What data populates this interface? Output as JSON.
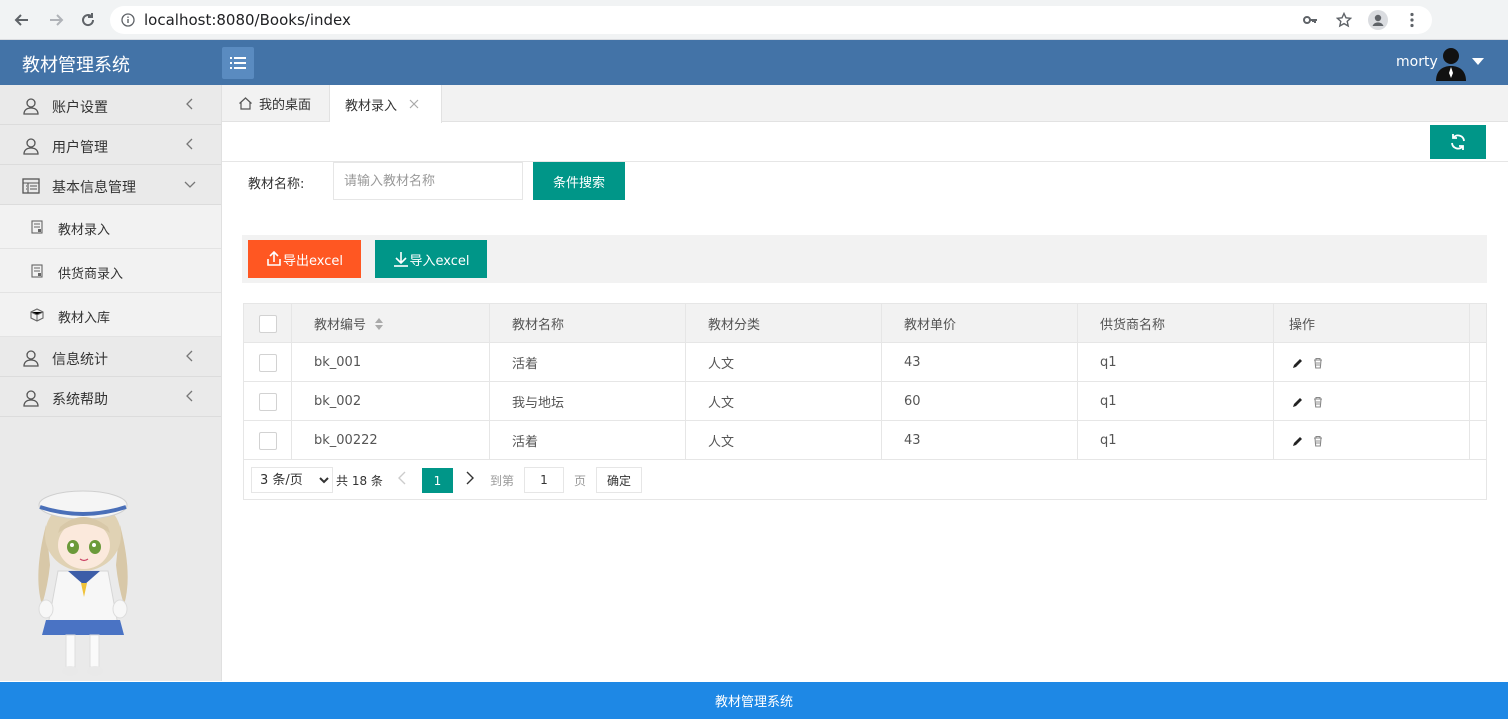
{
  "browser": {
    "url": "localhost:8080/Books/index"
  },
  "header": {
    "app_title": "教材管理系统",
    "user_name": "morty"
  },
  "sidebar": {
    "items": [
      {
        "label": "账户设置",
        "icon": "user-icon",
        "expanded": false
      },
      {
        "label": "用户管理",
        "icon": "user-icon",
        "expanded": false
      },
      {
        "label": "基本信息管理",
        "icon": "table-icon",
        "expanded": true
      },
      {
        "label": "信息统计",
        "icon": "user-icon",
        "expanded": false
      },
      {
        "label": "系统帮助",
        "icon": "user-icon",
        "expanded": false
      }
    ],
    "subitems": [
      {
        "label": "教材录入",
        "icon": "document-icon"
      },
      {
        "label": "供货商录入",
        "icon": "document-icon"
      },
      {
        "label": "教材入库",
        "icon": "box-icon"
      }
    ]
  },
  "tabs": {
    "home": "我的桌面",
    "active": "教材录入"
  },
  "search": {
    "label": "教材名称:",
    "placeholder": "请输入教材名称",
    "button": "条件搜索"
  },
  "toolbar": {
    "export_label": "导出excel",
    "import_label": "导入excel"
  },
  "table": {
    "headers": [
      "教材编号",
      "教材名称",
      "教材分类",
      "教材单价",
      "供货商名称",
      "操作"
    ],
    "rows": [
      [
        "bk_001",
        "活着",
        "人文",
        "43",
        "q1"
      ],
      [
        "bk_002",
        "我与地坛",
        "人文",
        "60",
        "q1"
      ],
      [
        "bk_00222",
        "活着",
        "人文",
        "43",
        "q1"
      ]
    ]
  },
  "pagination": {
    "page_size": "3 条/页",
    "total": "共 18 条",
    "current_page": "1",
    "goto_label": "到第",
    "goto_value": "1",
    "unit": "页",
    "confirm": "确定"
  },
  "footer": {
    "text": "教材管理系统"
  },
  "colors": {
    "header": "#4373a7",
    "primary": "#009688",
    "danger": "#ff5722",
    "footer": "#1e88e5"
  }
}
